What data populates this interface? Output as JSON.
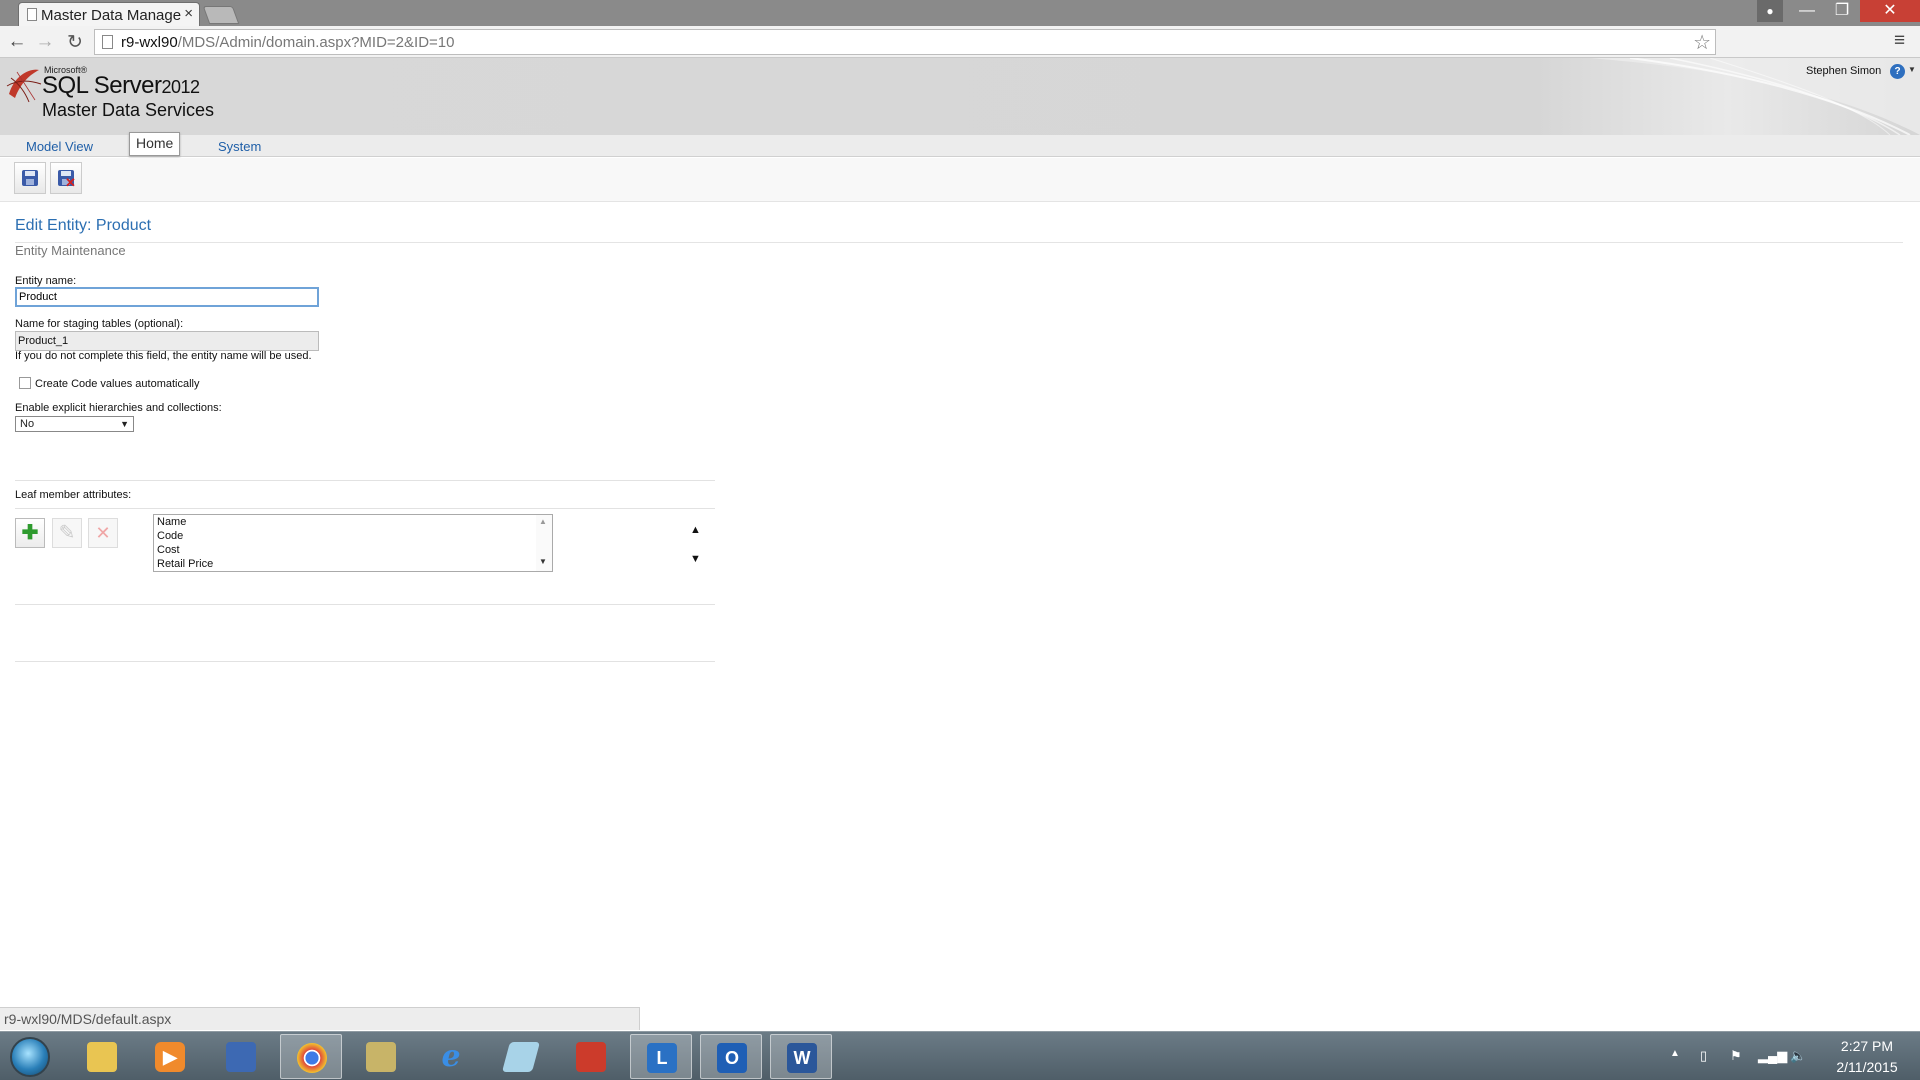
{
  "browser": {
    "tab_title": "Master Data Manage",
    "url_host": "r9-wxl90",
    "url_path": "/MDS/Admin/domain.aspx?MID=2&ID=10"
  },
  "header": {
    "brand_microsoft": "Microsoft®",
    "brand_product": "SQL Server",
    "brand_year": "2012",
    "brand_subtitle": "Master Data Services",
    "user_name": "Stephen Simon",
    "help_label": "?"
  },
  "nav": {
    "model_view": "Model View",
    "home": "Home",
    "system": "System"
  },
  "page": {
    "title": "Edit Entity: Product",
    "subtitle": "Entity Maintenance"
  },
  "form": {
    "entity_name_label": "Entity name:",
    "entity_name_value": "Product",
    "staging_label": "Name for staging tables (optional):",
    "staging_value": "Product_1",
    "staging_hint": "If you do not complete this field, the entity name will be used.",
    "create_code_label": "Create Code values automatically",
    "create_code_checked": false,
    "hierarchies_label": "Enable explicit hierarchies and collections:",
    "hierarchies_value": "No"
  },
  "attributes": {
    "label": "Leaf member attributes:",
    "items": [
      "Name",
      "Code",
      "Cost",
      "Retail Price"
    ]
  },
  "status_bar": {
    "text": "r9-wxl90/MDS/default.aspx"
  },
  "taskbar": {
    "apps": [
      "file-explorer",
      "media-player",
      "remote-desktop",
      "chrome",
      "sql-tool",
      "internet-explorer",
      "notepad",
      "toolbox",
      "lync",
      "outlook",
      "word"
    ],
    "lync_letter": "L",
    "outlook_letter": "O",
    "word_letter": "W",
    "clock_time": "2:27 PM",
    "clock_date": "2/11/2015"
  }
}
